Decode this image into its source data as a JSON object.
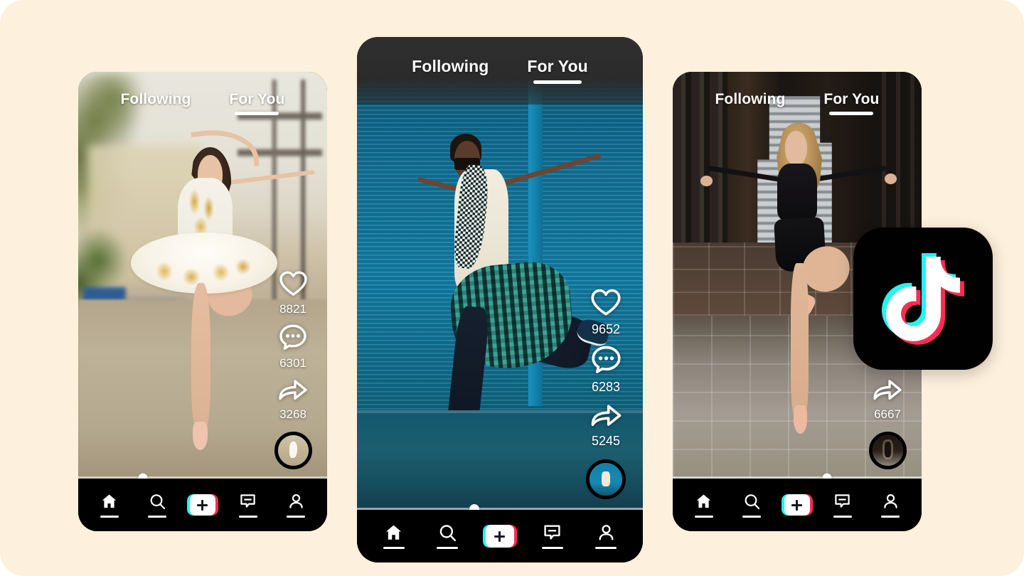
{
  "page": {
    "background_color": "#fdf0dc",
    "title": "TikTok app UI mockup — three phone screens"
  },
  "colors": {
    "brand_cyan": "#25f4ee",
    "brand_pink": "#fe2c55",
    "brand_black": "#010101",
    "nav_background": "#000000",
    "text_on_video": "#ffffff"
  },
  "tabs": {
    "following_label": "Following",
    "for_you_label": "For You",
    "active": "For You"
  },
  "bottom_nav": {
    "items": [
      {
        "name": "home",
        "icon": "home-icon",
        "label": ""
      },
      {
        "name": "discover",
        "icon": "search-icon",
        "label": ""
      },
      {
        "name": "create",
        "icon": "plus-icon",
        "label": ""
      },
      {
        "name": "inbox",
        "icon": "inbox-icon",
        "label": ""
      },
      {
        "name": "profile",
        "icon": "person-icon",
        "label": ""
      }
    ]
  },
  "phones": [
    {
      "id": "left",
      "video_description": "Ballerina in white and gold tutu on a sunlit street",
      "tabs": {
        "following": "Following",
        "for_you": "For You"
      },
      "actions": {
        "like": {
          "icon": "heart-icon",
          "count": "8821"
        },
        "comment": {
          "icon": "comment-icon",
          "count": "6301"
        },
        "share": {
          "icon": "share-arrow-icon",
          "count": "3268"
        }
      },
      "avatar": "creator-avatar",
      "progress_percent": 26
    },
    {
      "id": "center",
      "video_description": "Dancer in white tee and plaid shirt in front of a teal shutter",
      "tabs": {
        "following": "Following",
        "for_you": "For You"
      },
      "actions": {
        "like": {
          "icon": "heart-icon",
          "count": "9652"
        },
        "comment": {
          "icon": "comment-icon",
          "count": "6283"
        },
        "share": {
          "icon": "share-arrow-icon",
          "count": "5245"
        }
      },
      "avatar": "creator-avatar",
      "progress_percent": 41
    },
    {
      "id": "right",
      "video_description": "Dancer in black crop top leaping in a city plaza",
      "tabs": {
        "following": "Following",
        "for_you": "For You"
      },
      "actions": {
        "share": {
          "icon": "share-arrow-icon",
          "count": "6667"
        }
      },
      "avatar": "creator-avatar",
      "progress_percent": 62
    }
  ],
  "logo": {
    "name": "tiktok-logo",
    "shape": "rounded-square",
    "glyph": "music-note"
  }
}
